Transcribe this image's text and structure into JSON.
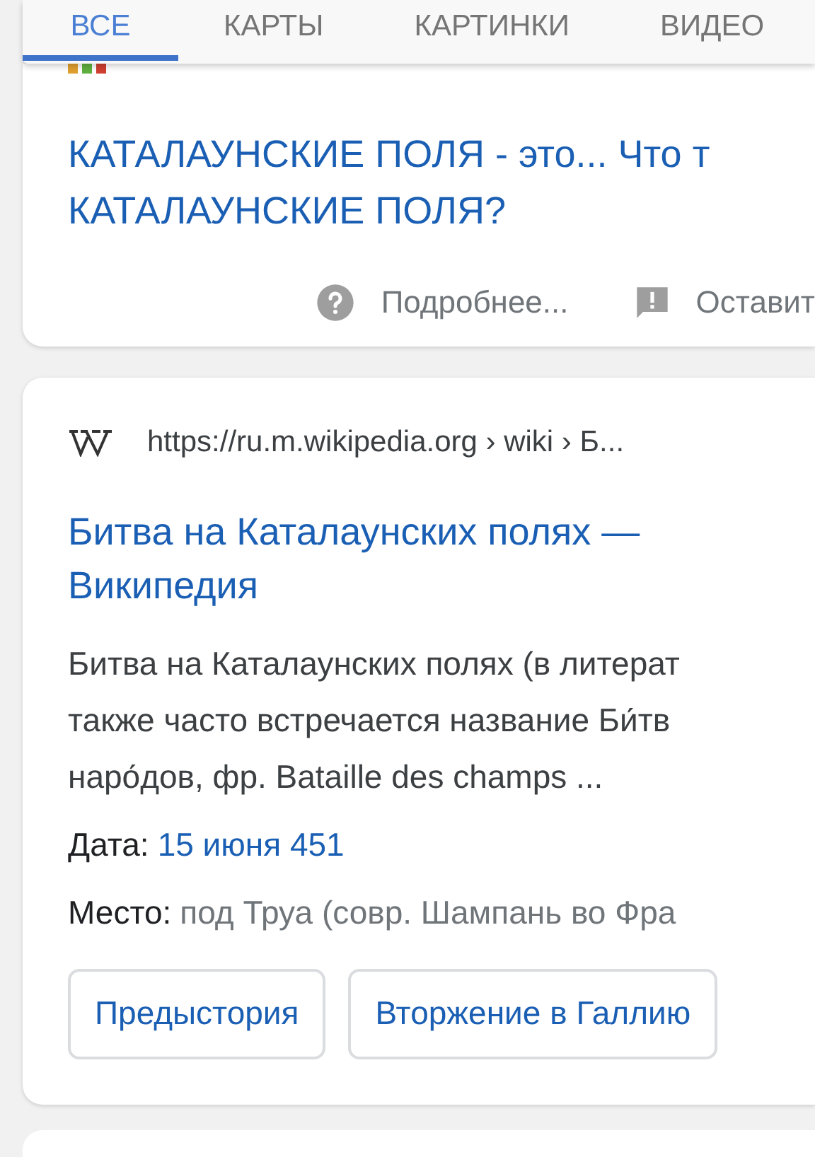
{
  "tabs": [
    {
      "label": "ВСЕ",
      "selected": true
    },
    {
      "label": "КАРТЫ",
      "selected": false
    },
    {
      "label": "КАРТИНКИ",
      "selected": false
    },
    {
      "label": "ВИДЕО",
      "selected": false
    }
  ],
  "results": [
    {
      "kind": "short",
      "title_lines": [
        "КАТАЛАУНСКИЕ ПОЛЯ - это... Что т",
        "КАТАЛАУНСКИЕ ПОЛЯ?"
      ],
      "actions": [
        {
          "kind": "help",
          "label": "Подробнее..."
        },
        {
          "kind": "feedback",
          "label": "Оставит"
        }
      ]
    },
    {
      "kind": "full",
      "url": "https://ru.m.wikipedia.org › wiki › Б...",
      "title_lines": [
        "Битва на Каталаунских полях —",
        "Википедия"
      ],
      "snippet_lines": [
        "Битва на Каталаунских полях (в литерат",
        "также часто встречается название Би́тв",
        "наро́дов, фр. Bataille des champs ..."
      ],
      "facts": [
        {
          "kind": "link",
          "label": "Дата:",
          "value": "15 июня 451"
        },
        {
          "kind": "plain",
          "label": "Место:",
          "value": "под Труа (совр. Шампань во Фра"
        }
      ],
      "chips": [
        "Предыстория",
        "Вторжение в Галлию"
      ]
    }
  ]
}
